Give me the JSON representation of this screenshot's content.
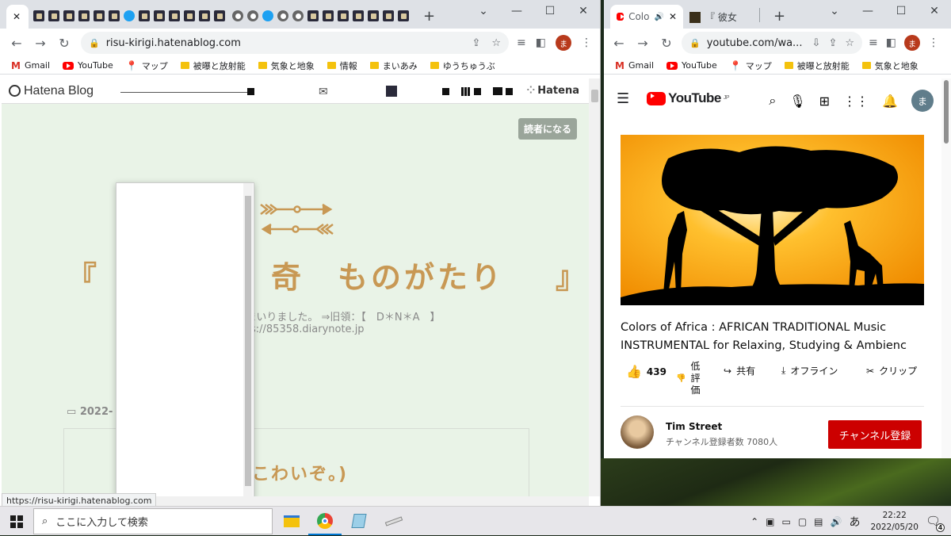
{
  "left_window": {
    "tab_close": "✕",
    "new_tab": "+",
    "controls": {
      "minimize": "—",
      "maximize": "☐",
      "close": "✕"
    },
    "address": "risu-kirigi.hatenablog.com",
    "bookmarks": [
      {
        "label": "Gmail",
        "icon": "gmail-icon"
      },
      {
        "label": "YouTube",
        "icon": "youtube-icon"
      },
      {
        "label": "マップ",
        "icon": "maps-icon"
      },
      {
        "label": "被曝と放射能",
        "icon": "folder-icon"
      },
      {
        "label": "気象と地象",
        "icon": "folder-icon"
      },
      {
        "label": "情報",
        "icon": "folder-icon"
      },
      {
        "label": "まいあみ",
        "icon": "folder-icon"
      },
      {
        "label": "ゆうちゅうぶ",
        "icon": "folder-icon"
      }
    ],
    "avatar_initial": "ま",
    "page": {
      "brand": "Hatena Blog",
      "hatena_label": "Hatena",
      "subscribe": "読者になる",
      "title_left": "『",
      "title_main": "奇　ものがたり",
      "title_right": "』",
      "subtitle": "【　　　　　　　　　　　てまいりました。 ⇒旧領：【　D＊N＊A　】",
      "subtitle_url": "s://85358.diarynote.jp",
      "date_partial": "2022-",
      "heading": "(　こわいぞ。)",
      "status_url": "https://risu-kirigi.hatenablog.com"
    }
  },
  "right_window": {
    "tabs": [
      {
        "label": "Colo",
        "icon": "youtube-icon",
        "audio": "🔊",
        "close": "✕"
      },
      {
        "label": "『 彼女",
        "close": ""
      }
    ],
    "new_tab": "+",
    "controls": {
      "minimize": "—",
      "maximize": "☐",
      "close": "✕"
    },
    "address": "youtube.com/wa...",
    "bookmarks": [
      {
        "label": "Gmail",
        "icon": "gmail-icon"
      },
      {
        "label": "YouTube",
        "icon": "youtube-icon"
      },
      {
        "label": "マップ",
        "icon": "maps-icon"
      },
      {
        "label": "被曝と放射能",
        "icon": "folder-icon"
      },
      {
        "label": "気象と地象",
        "icon": "folder-icon"
      }
    ],
    "avatar_initial": "ま",
    "youtube": {
      "logo": "YouTube",
      "region": "JP",
      "video_title": "Colors of Africa : AFRICAN TRADITIONAL Music INSTRUMENTAL for Relaxing, Studying & Ambienc",
      "likes": "439",
      "dislike": "低\n評\n価",
      "share": "共有",
      "offline": "オフライン",
      "clip": "クリップ",
      "channel_name": "Tim Street",
      "channel_subs": "チャンネル登録者数 7080人",
      "subscribe": "チャンネル登録",
      "account_initial": "ま"
    }
  },
  "taskbar": {
    "search_placeholder": "ここに入力して検索",
    "ime": "あ",
    "time": "22:22",
    "date": "2022/05/20",
    "notification_count": "4"
  },
  "colors": {
    "accent_title": "#c89854",
    "page_bg": "#e9f3e7",
    "yt_red": "#ff0000",
    "subscribe_red": "#cc0000"
  }
}
